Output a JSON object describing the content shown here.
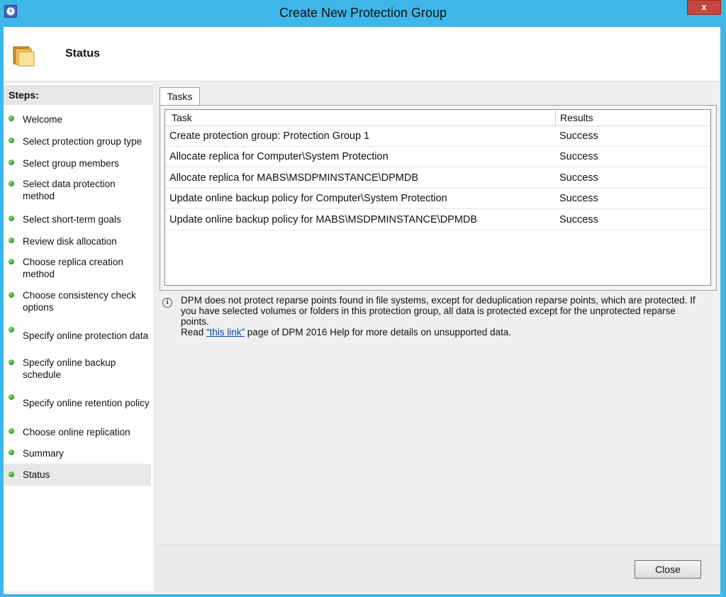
{
  "window": {
    "title": "Create New Protection Group",
    "close_glyph": "x"
  },
  "header": {
    "title": "Status",
    "icon": "folder-icon"
  },
  "sidebar": {
    "heading": "Steps:",
    "status_color": "#2b9a1c",
    "items": [
      {
        "label": "Welcome"
      },
      {
        "label": "Select protection group type"
      },
      {
        "label": "Select group members"
      },
      {
        "label": "Select data protection method"
      },
      {
        "label": "Select short-term goals"
      },
      {
        "label": "Review disk allocation"
      },
      {
        "label": "Choose replica creation method"
      },
      {
        "label": "Choose consistency check options"
      },
      {
        "label": "Specify online protection data"
      },
      {
        "label": "Specify online backup schedule"
      },
      {
        "label": "Specify online retention policy"
      },
      {
        "label": "Choose online replication"
      },
      {
        "label": "Summary"
      },
      {
        "label": "Status",
        "active": true
      }
    ]
  },
  "tasks": {
    "tab_label": "Tasks",
    "columns": [
      "Task",
      "Results"
    ],
    "rows": [
      {
        "task": "Create protection group: Protection Group 1",
        "result": "Success"
      },
      {
        "task": "Allocate replica for Computer\\System Protection",
        "result": "Success"
      },
      {
        "task": "Allocate replica for MABS\\MSDPMINSTANCE\\DPMDB",
        "result": "Success"
      },
      {
        "task": "Update online backup policy for Computer\\System Protection",
        "result": "Success"
      },
      {
        "task": "Update online backup policy for MABS\\MSDPMINSTANCE\\DPMDB",
        "result": "Success"
      }
    ]
  },
  "info": {
    "icon": "info-icon",
    "line1": "DPM does not protect reparse points found in file systems, except for deduplication reparse points, which are protected. If you have selected volumes or folders in this protection group, all data is protected except for the unprotected reparse points.",
    "read_prefix": "Read ",
    "link_text": "“this link”",
    "read_suffix": " page of DPM 2016 Help for more details on unsupported data."
  },
  "footer": {
    "close_label": "Close"
  }
}
